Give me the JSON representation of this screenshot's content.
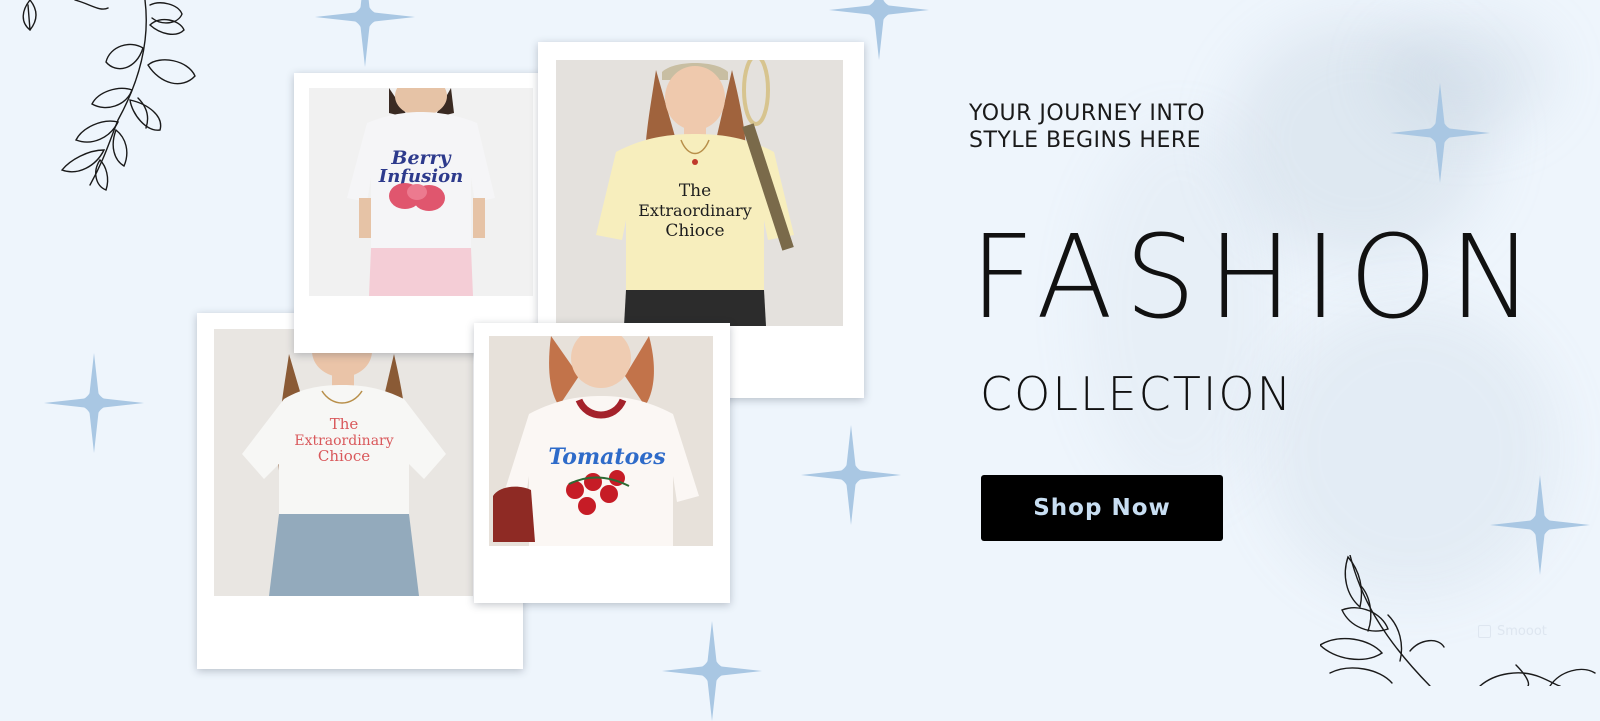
{
  "hero": {
    "tagline_line1": "YOUR JOURNEY INTO",
    "tagline_line2": "STYLE BEGINS HERE",
    "title": "FASHION",
    "subtitle": "COLLECTION",
    "cta_label": "Shop Now"
  },
  "photos": [
    {
      "name": "berry-infusion-tee",
      "shirt_line1": "Berry",
      "shirt_line2": "Infusion"
    },
    {
      "name": "extraordinary-choice-yellow-tee",
      "shirt_line1": "The",
      "shirt_line2": "Extraordinary",
      "shirt_line3": "Chioce"
    },
    {
      "name": "extraordinary-choice-white-tee",
      "shirt_line1": "The",
      "shirt_line2": "Extraordinary",
      "shirt_line3": "Chioce"
    },
    {
      "name": "tomatoes-tee",
      "shirt_line1": "Tomatoes"
    }
  ],
  "watermark": "Smooot",
  "icons": {
    "sparkle": "sparkle-icon",
    "vine": "vine-branch-icon",
    "watermark": "watermark-icon"
  },
  "colors": {
    "background": "#eef5fc",
    "sparkle": "#a9c7e3",
    "button_bg": "#000000",
    "button_text": "#c8def2",
    "text": "#111111"
  }
}
